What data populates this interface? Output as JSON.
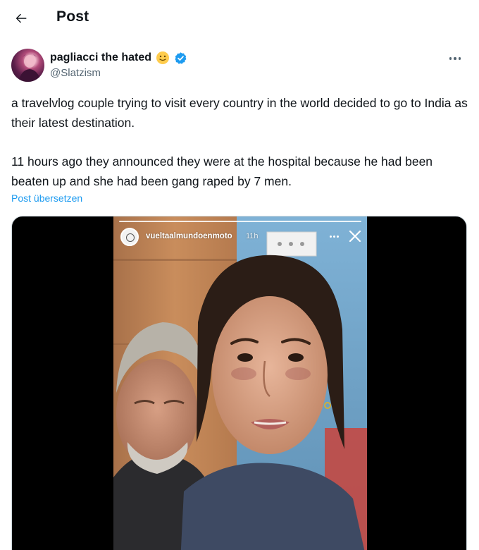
{
  "header": {
    "title": "Post",
    "back_icon": "arrow-left-icon"
  },
  "author": {
    "display_name": "pagliacci the hated",
    "emoji": "🙂",
    "handle": "@Slatzism",
    "verified_color": "#1d9bf0",
    "more_icon": "more-horizontal-icon"
  },
  "tweet": {
    "paragraphs": [
      "a travelvlog couple trying to visit every country in the world decided to go to India as their latest destination.",
      "11 hours ago they announced they were at the hospital because he had been beaten up and she had been gang raped by 7 men."
    ],
    "translate_label": "Post übersetzen"
  },
  "media": {
    "story_username": "vueltaalmundoenmoto",
    "story_time": "11h",
    "close_icon": "close-icon",
    "story_more_icon": "more-horizontal-icon"
  },
  "colors": {
    "link": "#1d9bf0",
    "secondary_text": "#536471",
    "primary_text": "#0f1419"
  }
}
